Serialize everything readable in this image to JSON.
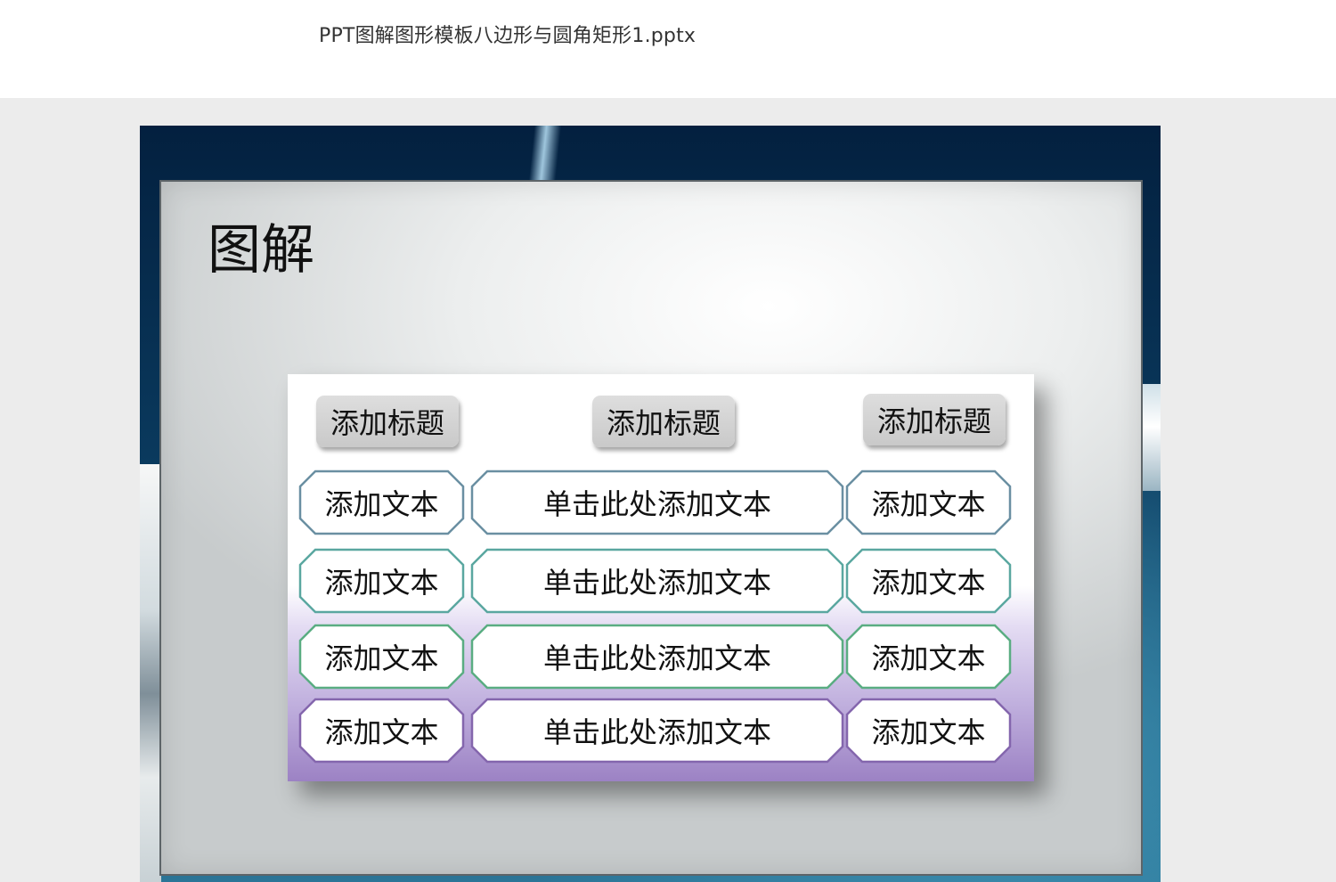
{
  "file": {
    "title": "PPT图解图形模板八边形与圆角矩形1.pptx"
  },
  "slide": {
    "title": "图解",
    "headers": [
      "添加标题",
      "添加标题",
      "添加标题"
    ],
    "rows": [
      {
        "left": "添加文本",
        "center": "单击此处添加文本",
        "right": "添加文本",
        "border_color": "#6a8fa2"
      },
      {
        "left": "添加文本",
        "center": "单击此处添加文本",
        "right": "添加文本",
        "border_color": "#5aa7a0"
      },
      {
        "left": "添加文本",
        "center": "单击此处添加文本",
        "right": "添加文本",
        "border_color": "#5aad82"
      },
      {
        "left": "添加文本",
        "center": "单击此处添加文本",
        "right": "添加文本",
        "border_color": "#8466ad"
      }
    ]
  }
}
